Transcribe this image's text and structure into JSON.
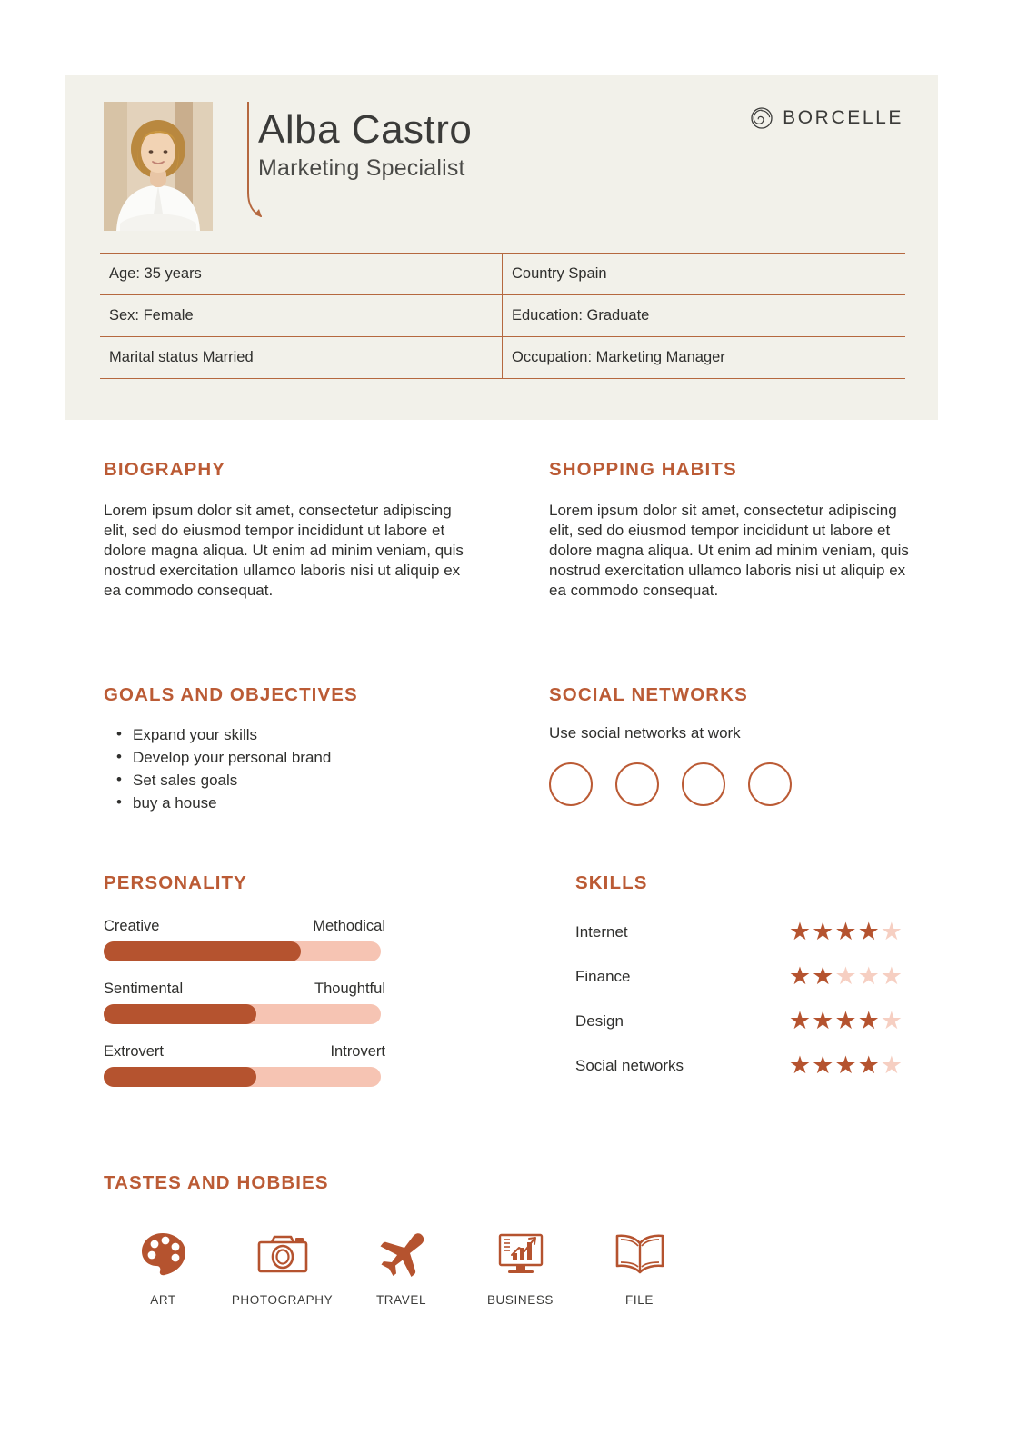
{
  "brand": {
    "name": "BORCELLE",
    "logo_icon": "spiral-circle-icon"
  },
  "person": {
    "name": "Alba Castro",
    "role": "Marketing Specialist",
    "photo_alt": "portrait-photo"
  },
  "info_table": [
    {
      "left": "Age: 35 years",
      "right": "Country Spain"
    },
    {
      "left": "Sex: Female",
      "right": "Education: Graduate"
    },
    {
      "left": "Marital status Married",
      "right": "Occupation: Marketing Manager"
    }
  ],
  "biography": {
    "title": "BIOGRAPHY",
    "text": "Lorem ipsum dolor sit amet, consectetur adipiscing elit, sed do eiusmod tempor incididunt ut labore et dolore magna aliqua. Ut enim ad minim veniam, quis nostrud exercitation ullamco laboris nisi ut aliquip ex ea commodo consequat."
  },
  "shopping_habits": {
    "title": "SHOPPING HABITS",
    "text": "Lorem ipsum dolor sit amet, consectetur adipiscing elit, sed do eiusmod tempor incididunt ut labore et dolore magna aliqua. Ut enim ad minim veniam, quis nostrud exercitation ullamco laboris nisi ut aliquip ex ea commodo consequat."
  },
  "goals": {
    "title": "GOALS AND OBJECTIVES",
    "items": [
      "Expand your skills",
      "Develop your personal brand",
      "Set sales goals",
      "buy a house"
    ]
  },
  "social_networks": {
    "title": "SOCIAL NETWORKS",
    "note": "Use social networks at work",
    "circles": 4
  },
  "personality": {
    "title": "PERSONALITY",
    "sliders": [
      {
        "left_label": "Creative",
        "right_label": "Methodical",
        "fill_percent": 71
      },
      {
        "left_label": "Sentimental",
        "right_label": "Thoughtful",
        "fill_percent": 55
      },
      {
        "left_label": "Extrovert",
        "right_label": "Introvert",
        "fill_percent": 55
      }
    ]
  },
  "skills": {
    "title": "SKILLS",
    "max_stars": 5,
    "items": [
      {
        "name": "Internet",
        "rating": 4
      },
      {
        "name": "Finance",
        "rating": 2
      },
      {
        "name": "Design",
        "rating": 4
      },
      {
        "name": "Social networks",
        "rating": 4
      }
    ]
  },
  "hobbies": {
    "title": "TASTES AND HOBBIES",
    "items": [
      {
        "label": "ART",
        "icon": "palette-icon"
      },
      {
        "label": "PHOTOGRAPHY",
        "icon": "camera-icon"
      },
      {
        "label": "TRAVEL",
        "icon": "airplane-icon"
      },
      {
        "label": "BUSINESS",
        "icon": "chart-monitor-icon"
      },
      {
        "label": "FILE",
        "icon": "open-book-icon"
      }
    ]
  },
  "colors": {
    "accent": "#bb5b35",
    "accent_dark": "#b5532f",
    "accent_light": "#f6c4b3",
    "panel_bg": "#f2f1ea",
    "text": "#2f2f2d"
  }
}
